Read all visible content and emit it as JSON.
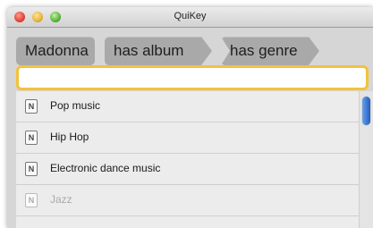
{
  "window": {
    "title": "QuiKey"
  },
  "query_chips": [
    "Madonna",
    "has album",
    "has genre"
  ],
  "search": {
    "value": "",
    "placeholder": ""
  },
  "results": [
    {
      "icon": "N",
      "label": "Pop music"
    },
    {
      "icon": "N",
      "label": "Hip Hop"
    },
    {
      "icon": "N",
      "label": "Electronic dance music"
    },
    {
      "icon": "N",
      "label": "Jazz"
    }
  ],
  "colors": {
    "chip_background": "#a9a9a9",
    "search_focus_border": "#f2c23a",
    "scroll_thumb": "#3b78d6"
  }
}
